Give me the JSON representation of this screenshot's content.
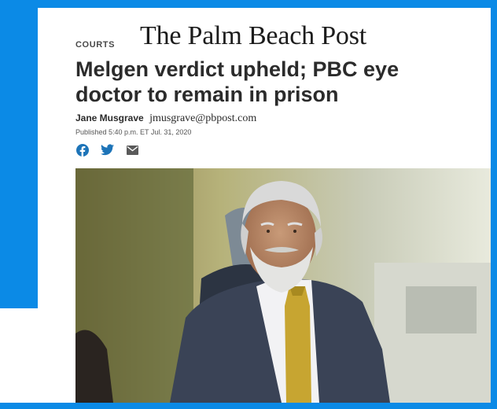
{
  "masthead": {
    "title": "The Palm Beach Post"
  },
  "article": {
    "section": "COURTS",
    "headline": "Melgen verdict upheld; PBC eye doctor to remain in prison",
    "author": "Jane Musgrave",
    "email": "jmusgrave@pbpost.com",
    "published": "Published 5:40 p.m. ET Jul. 31, 2020"
  },
  "share": {
    "icons": [
      "facebook-icon",
      "twitter-icon",
      "email-icon"
    ]
  },
  "colors": {
    "frame_blue": "#0b8ae6",
    "share_icon": "#1d74b8",
    "headline": "#2b2b2b"
  },
  "photo": {
    "subject": "photo-of-man-in-suit"
  }
}
